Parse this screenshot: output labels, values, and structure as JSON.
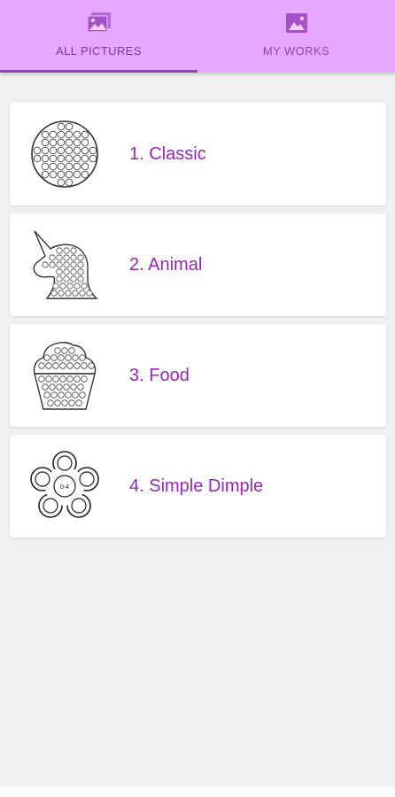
{
  "tabs": [
    {
      "label": "ALL PICTURES",
      "icon": "gallery-icon",
      "active": true
    },
    {
      "label": "MY WORKS",
      "icon": "gallery-icon",
      "active": false
    }
  ],
  "items": [
    {
      "title": "1. Classic",
      "icon": "round-pop-it-icon"
    },
    {
      "title": "2. Animal",
      "icon": "unicorn-pop-it-icon"
    },
    {
      "title": "3. Food",
      "icon": "cupcake-pop-it-icon"
    },
    {
      "title": "4. Simple Dimple",
      "icon": "flower-simple-dimple-icon"
    }
  ],
  "colors": {
    "tab_bar": "#e6a8ff",
    "indicator": "#9c3fbd",
    "item_text": "#9a26b8",
    "background": "#f0f0f0"
  }
}
